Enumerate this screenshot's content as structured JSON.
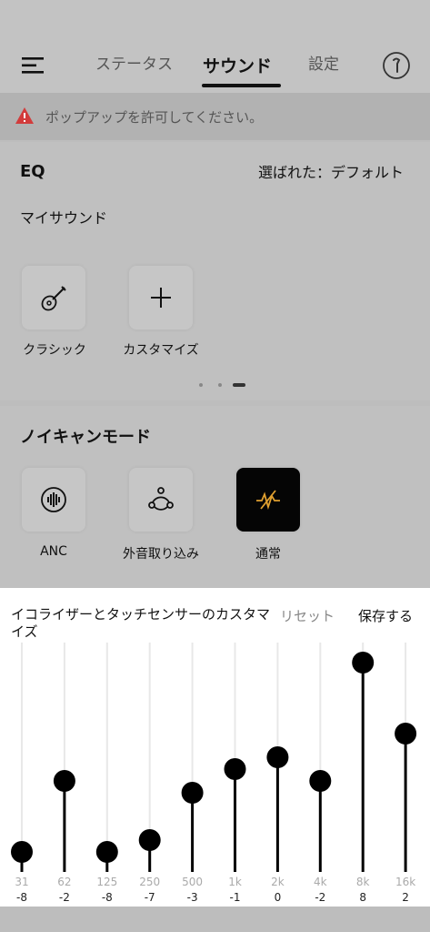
{
  "header": {
    "tabs": [
      {
        "label": "ステータス",
        "active": false
      },
      {
        "label": "サウンド",
        "active": true
      },
      {
        "label": "設定",
        "active": false
      }
    ],
    "menu_icon": "menu-icon",
    "device_icon": "earbud-icon"
  },
  "alert": {
    "text": "ポップアップを許可してください。",
    "icon": "warning-icon",
    "color": "#d23c3c"
  },
  "eq": {
    "title": "EQ",
    "selected": "選ばれた：デフォルト",
    "subtitle": "マイサウンド",
    "presets": [
      {
        "label": "クラシック",
        "icon": "guitar-icon"
      },
      {
        "label": "カスタマイズ",
        "icon": "plus-icon"
      }
    ]
  },
  "noise": {
    "title": "ノイキャンモード",
    "modes": [
      {
        "label": "ANC",
        "icon": "anc-waveform-icon",
        "selected": false
      },
      {
        "label": "外音取り込み",
        "icon": "ambient-icon",
        "selected": false
      },
      {
        "label": "通常",
        "icon": "normal-mode-icon",
        "selected": true
      }
    ],
    "accent": "#e0a030"
  },
  "sheet": {
    "title": "イコライザーとタッチセンサーのカスタマイズ",
    "reset": "リセット",
    "save": "保存する",
    "bands": [
      {
        "freq": "31",
        "value": -8
      },
      {
        "freq": "62",
        "value": -2
      },
      {
        "freq": "125",
        "value": -8
      },
      {
        "freq": "250",
        "value": -7
      },
      {
        "freq": "500",
        "value": -3
      },
      {
        "freq": "1k",
        "value": -1
      },
      {
        "freq": "2k",
        "value": 0
      },
      {
        "freq": "4k",
        "value": -2
      },
      {
        "freq": "8k",
        "value": 8
      },
      {
        "freq": "16k",
        "value": 2
      }
    ]
  }
}
